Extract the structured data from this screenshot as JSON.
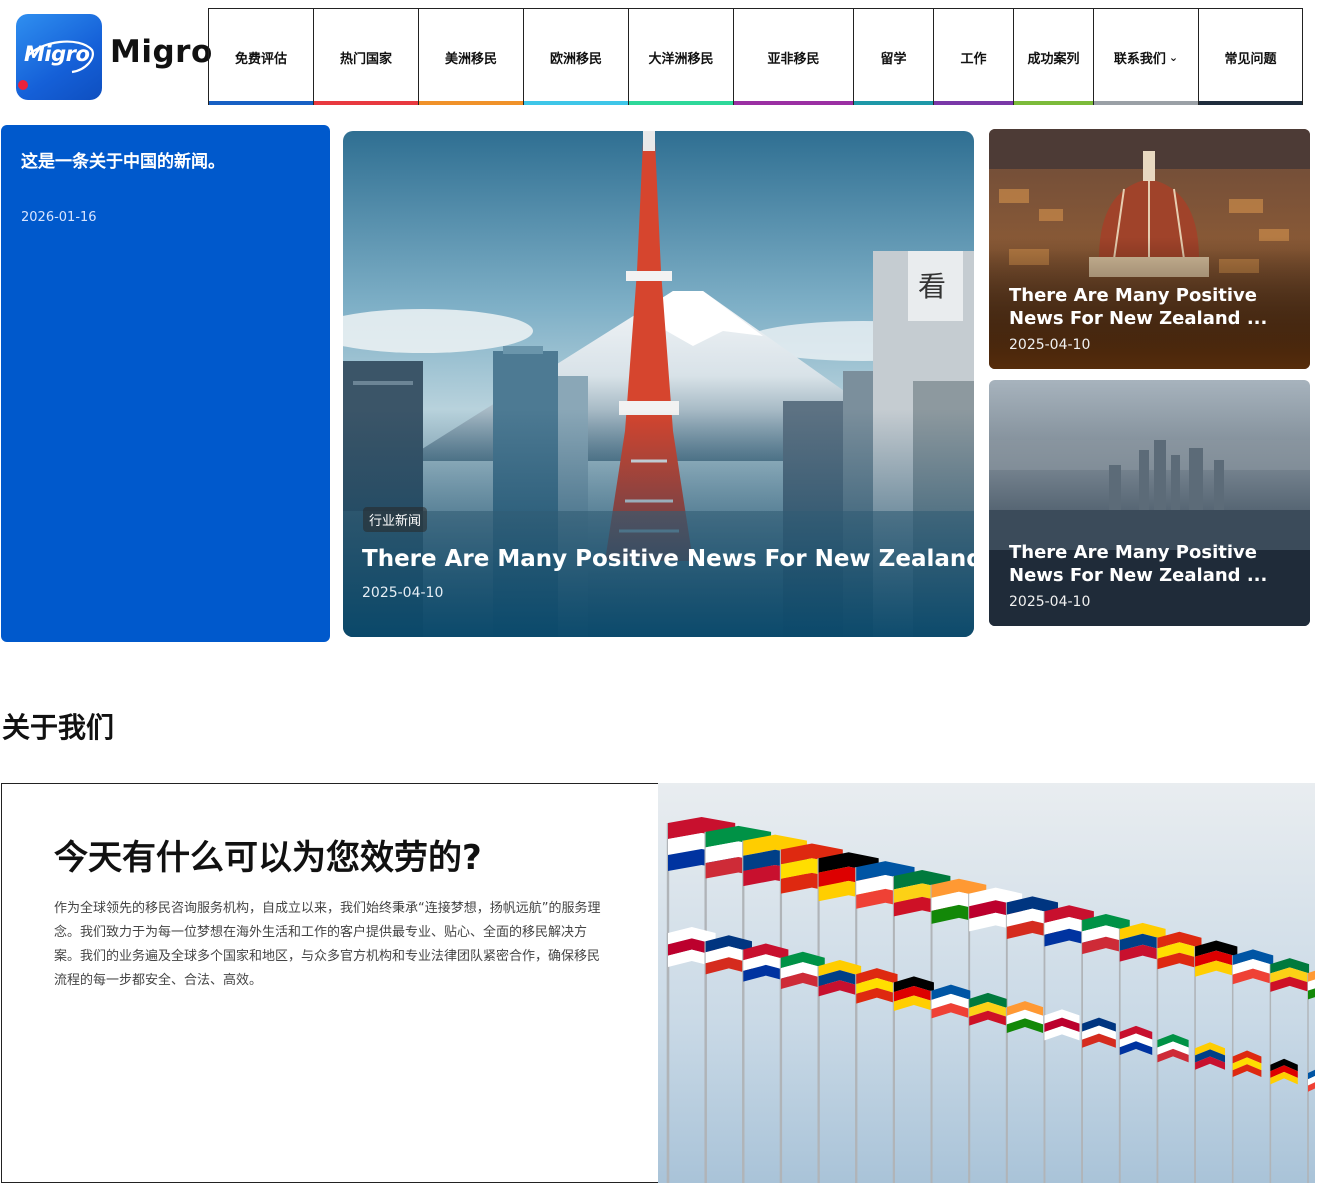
{
  "brand": {
    "logo_script": "Migro",
    "name": "Migro"
  },
  "nav": {
    "items": [
      {
        "label": "免费评估",
        "color": "#1760c4"
      },
      {
        "label": "热门国家",
        "color": "#e8393f"
      },
      {
        "label": "美洲移民",
        "color": "#f0922a"
      },
      {
        "label": "欧洲移民",
        "color": "#3ec6e8"
      },
      {
        "label": "大洋洲移民",
        "color": "#2ed89a"
      },
      {
        "label": "亚非移民",
        "color": "#9b2fa3"
      },
      {
        "label": "留学",
        "color": "#1e98a8"
      },
      {
        "label": "工作",
        "color": "#7a38a8"
      },
      {
        "label": "成功案列",
        "color": "#7cbb3a"
      },
      {
        "label": "联系我们",
        "color": "#9aa0a6",
        "dropdown": true
      },
      {
        "label": "常见问题",
        "color": "#1f2d3d"
      }
    ]
  },
  "featured": {
    "blue_card": {
      "title": "这是一条关于中国的新闻。",
      "date": "2026-01-16",
      "color": "#0059cc"
    },
    "hero": {
      "tag": "行业新闻",
      "title": "There Are Many Positive News For New Zealand ...",
      "date": "2025-04-10"
    },
    "side_cards": [
      {
        "title": "There Are Many Positive News For New Zealand ...",
        "date": "2025-04-10"
      },
      {
        "title": "There Are Many Positive News For New Zealand ...",
        "date": "2025-04-10"
      }
    ]
  },
  "about": {
    "heading": "关于我们",
    "title": "今天有什么可以为您效劳的?",
    "text": "作为全球领先的移民咨询服务机构，自成立以来，我们始终秉承“连接梦想，扬帆远航”的服务理念。我们致力于为每一位梦想在海外生活和工作的客户提供最专业、贴心、全面的移民解决方案。我们的业务遍及全球多个国家和地区，与众多官方机构和专业法律团队紧密合作，确保移民流程的每一步都安全、合法、高效。"
  }
}
